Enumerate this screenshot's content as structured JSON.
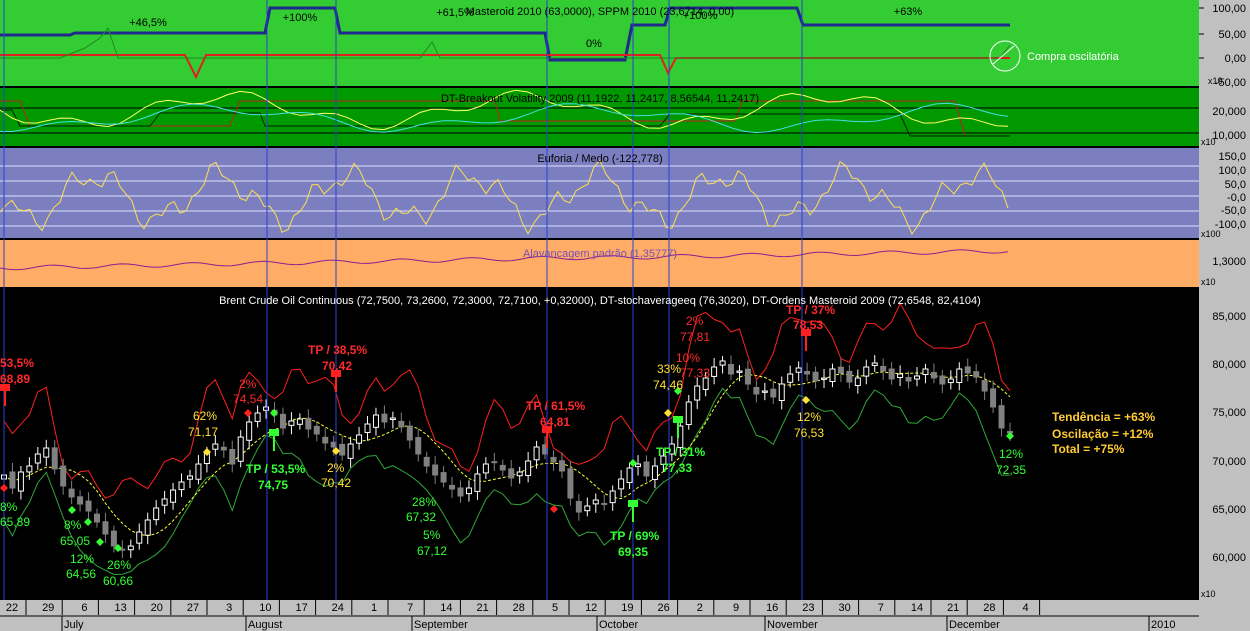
{
  "colors": {
    "green_bg": "#33cc33",
    "dark_green_bg": "#009900",
    "purple_bg": "#7b7fbf",
    "orange_bg": "#ffad66",
    "price_bg": "#000000",
    "axis_bg": "#c0c0c0",
    "red_line": "#ff2020",
    "green_line": "#2fa83a",
    "yellow_line": "#ffff33",
    "blue_line": "#1f2a8c",
    "vline": "#2b3fd6",
    "bull_candle": "#ffffff",
    "bear_candle": "#808080",
    "label_red": "#ff2a2a",
    "label_green": "#33ff33",
    "label_yellow": "#ffe033"
  },
  "panels": [
    {
      "id": "masteroid",
      "title": "Masteroid 2010 (63,0000), SPPM 2010 (23,6714, 0,00)",
      "ticks": [
        "100,00",
        "50,00",
        "0,00",
        "-50,00"
      ],
      "scale": "x10",
      "annotations": [
        "+46,5%",
        "+100%",
        "+61,5%",
        "0%",
        "+100%",
        "+63%"
      ],
      "legend": "Compra oscilatória"
    },
    {
      "id": "breakout",
      "title": "DT-Breakout Volatility 2009 (11,1922, 11,2417, 8,56544, 11,2417)",
      "ticks": [
        "20,000",
        "10,000"
      ],
      "scale": "x10"
    },
    {
      "id": "euforia",
      "title": "Euforia / Medo (-122,778)",
      "ticks": [
        "150,0",
        "100,0",
        "50,0",
        "-0,0",
        "-50,0",
        "-100,0"
      ],
      "scale": "x100"
    },
    {
      "id": "alavancagem",
      "title": "Alavancagem padrão (1,35777)",
      "ticks": [
        "1,3000"
      ],
      "scale": "x10"
    }
  ],
  "chart_data": {
    "type": "candlestick",
    "title": "Brent Crude Oil Continuous (72,7500, 73,2600, 72,3000, 72,7100, +0,32000), DT-stochaverageeq (76,3020), DT-Ordens Masteroid 2009 (72,6548, 82,4104)",
    "ylim": [
      56,
      87
    ],
    "y_ticks": [
      "85,000",
      "80,000",
      "75,000",
      "70,000",
      "65,000",
      "60,000"
    ],
    "x_day_ticks": [
      "22",
      "29",
      "6",
      "13",
      "20",
      "27",
      "3",
      "10",
      "17",
      "24",
      "1",
      "7",
      "14",
      "21",
      "28",
      "5",
      "12",
      "19",
      "26",
      "2",
      "9",
      "16",
      "23",
      "30",
      "7",
      "14",
      "21",
      "28",
      "4"
    ],
    "x_month_labels": [
      "July",
      "August",
      "September",
      "October",
      "November",
      "December",
      "2010"
    ],
    "axis_scale": "x10",
    "summary": [
      "Tendência = +63%",
      "Oscilação = +12%",
      "Total = +75%"
    ],
    "trade_labels": [
      {
        "text": "53,5%",
        "color": "red"
      },
      {
        "text": "68,89",
        "color": "red"
      },
      {
        "text": "8%",
        "color": "green"
      },
      {
        "text": "65,89",
        "color": "green"
      },
      {
        "text": "8%",
        "color": "green"
      },
      {
        "text": "65,05",
        "color": "green"
      },
      {
        "text": "12%",
        "color": "green"
      },
      {
        "text": "64,56",
        "color": "green"
      },
      {
        "text": "26%",
        "color": "green"
      },
      {
        "text": "60,66",
        "color": "green"
      },
      {
        "text": "62%",
        "color": "yellow"
      },
      {
        "text": "71,17",
        "color": "yellow"
      },
      {
        "text": "2%",
        "color": "red"
      },
      {
        "text": "74,54",
        "color": "red"
      },
      {
        "text": "TP / 53,5%",
        "color": "green"
      },
      {
        "text": "74,75",
        "color": "green"
      },
      {
        "text": "TP / 38,5%",
        "color": "red"
      },
      {
        "text": "70,42",
        "color": "red"
      },
      {
        "text": "2%",
        "color": "yellow"
      },
      {
        "text": "70,42",
        "color": "yellow"
      },
      {
        "text": "28%",
        "color": "green"
      },
      {
        "text": "67,32",
        "color": "green"
      },
      {
        "text": "5%",
        "color": "green"
      },
      {
        "text": "67,12",
        "color": "green"
      },
      {
        "text": "TP / 61,5%",
        "color": "red"
      },
      {
        "text": "64,81",
        "color": "red"
      },
      {
        "text": "TP / 69%",
        "color": "green"
      },
      {
        "text": "69,35",
        "color": "green"
      },
      {
        "text": "TP / 31%",
        "color": "green"
      },
      {
        "text": "77,33",
        "color": "green"
      },
      {
        "text": "33%",
        "color": "yellow"
      },
      {
        "text": "74,46",
        "color": "yellow"
      },
      {
        "text": "10%",
        "color": "red"
      },
      {
        "text": "77,33",
        "color": "red"
      },
      {
        "text": "2%",
        "color": "red"
      },
      {
        "text": "77,81",
        "color": "red"
      },
      {
        "text": "TP / 37%",
        "color": "red"
      },
      {
        "text": "78,53",
        "color": "red"
      },
      {
        "text": "12%",
        "color": "yellow"
      },
      {
        "text": "76,53",
        "color": "yellow"
      },
      {
        "text": "12%",
        "color": "green"
      },
      {
        "text": "72,35",
        "color": "green"
      }
    ],
    "close_series": [
      68.5,
      67.2,
      68.8,
      69.4,
      70.6,
      71.2,
      69.1,
      67.4,
      66.3,
      65.6,
      64.9,
      63.8,
      62.6,
      61.4,
      61.0,
      61.4,
      62.8,
      64.0,
      65.2,
      66.1,
      67.0,
      67.8,
      68.4,
      69.6,
      70.8,
      71.6,
      71.0,
      69.6,
      72.3,
      73.8,
      74.7,
      75.3,
      74.5,
      73.2,
      73.9,
      74.1,
      73.1,
      72.6,
      71.7,
      71.3,
      70.5,
      71.6,
      72.5,
      73.6,
      74.5,
      73.8,
      74.2,
      73.3,
      72.0,
      70.6,
      69.4,
      68.5,
      67.8,
      67.1,
      66.4,
      67.2,
      68.6,
      69.6,
      69.8,
      69.0,
      68.2,
      68.8,
      69.9,
      71.3,
      70.6,
      69.8,
      68.9,
      66.2,
      64.8,
      65.4,
      66.0,
      65.6,
      66.9,
      68.1,
      69.2,
      69.6,
      68.4,
      69.4,
      70.4,
      71.6,
      73.4,
      75.8,
      77.4,
      78.2,
      79.3,
      79.9,
      78.6,
      78.9,
      77.6,
      76.6,
      76.9,
      76.3,
      77.6,
      78.6,
      79.2,
      78.6,
      77.9,
      78.2,
      79.1,
      78.7,
      77.8,
      78.2,
      79.3,
      79.7,
      78.9,
      78.1,
      78.6,
      77.9,
      78.4,
      79.1,
      78.2,
      77.6,
      78.1,
      79.1,
      78.7,
      78.3,
      76.9,
      75.3,
      73.2,
      72.7
    ]
  }
}
